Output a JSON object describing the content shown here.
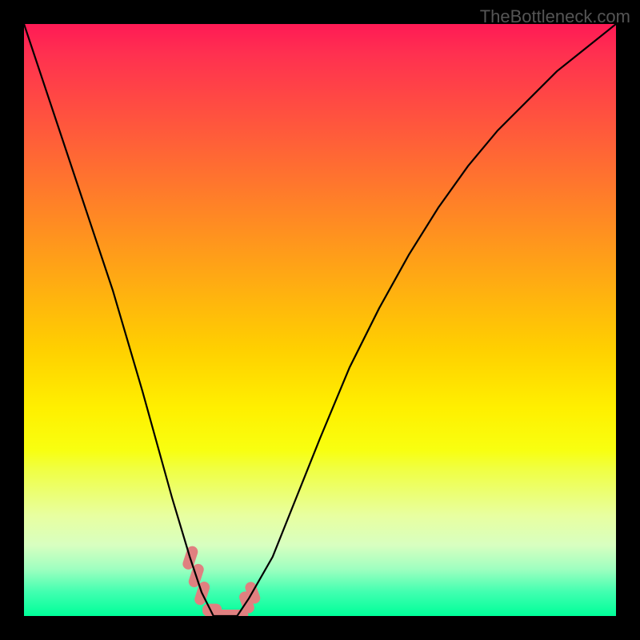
{
  "watermark": "TheBottleneck.com",
  "chart_data": {
    "type": "line",
    "title": "",
    "xlabel": "",
    "ylabel": "",
    "xlim": [
      0,
      100
    ],
    "ylim": [
      0,
      100
    ],
    "series": [
      {
        "name": "bottleneck-curve",
        "x": [
          0,
          5,
          10,
          15,
          20,
          25,
          28,
          30,
          32,
          34,
          35,
          36,
          38,
          42,
          46,
          50,
          55,
          60,
          65,
          70,
          75,
          80,
          85,
          90,
          95,
          100
        ],
        "y": [
          100,
          85,
          70,
          55,
          38,
          20,
          10,
          4,
          0,
          0,
          0,
          0,
          3,
          10,
          20,
          30,
          42,
          52,
          61,
          69,
          76,
          82,
          87,
          92,
          96,
          100
        ]
      }
    ],
    "highlight_region": {
      "name": "optimal-zone",
      "x": [
        28,
        38
      ],
      "color": "#e08080"
    },
    "gradient_stops": [
      {
        "pos": 0,
        "color": "#ff1a55"
      },
      {
        "pos": 50,
        "color": "#fff000"
      },
      {
        "pos": 100,
        "color": "#00ff99"
      }
    ]
  }
}
